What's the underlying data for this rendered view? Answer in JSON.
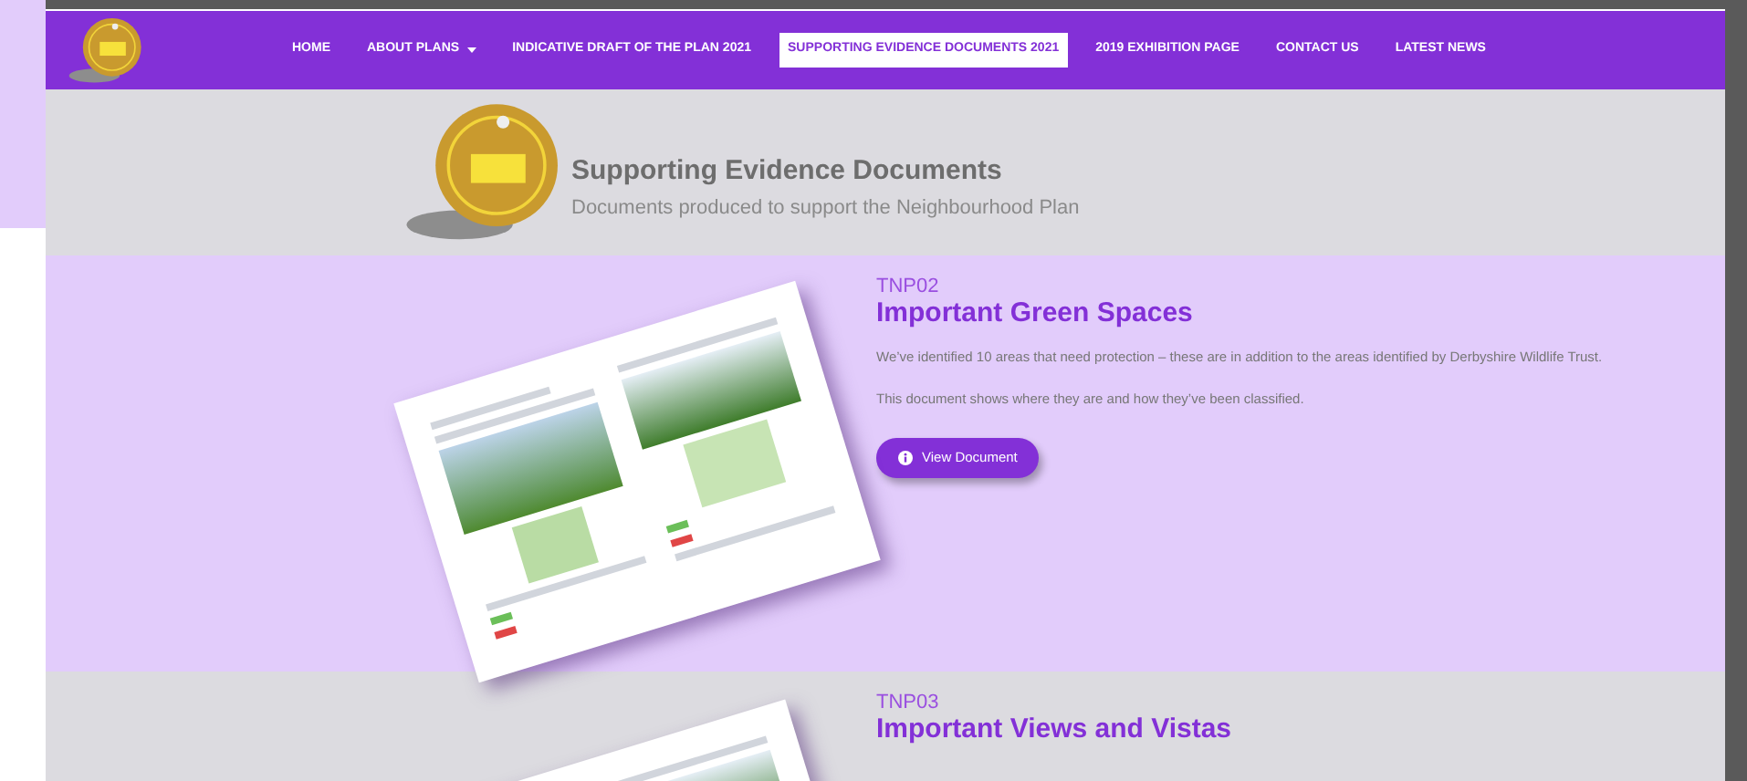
{
  "nav": [
    {
      "label": "HOME",
      "selected": false,
      "dropdown": false
    },
    {
      "label": "ABOUT PLANS",
      "selected": false,
      "dropdown": true
    },
    {
      "label": "INDICATIVE DRAFT OF THE PLAN 2021",
      "selected": false,
      "dropdown": false
    },
    {
      "label": "SUPPORTING EVIDENCE DOCUMENTS 2021",
      "selected": true,
      "dropdown": false
    },
    {
      "label": "2019 EXHIBITION PAGE",
      "selected": false,
      "dropdown": false
    },
    {
      "label": "CONTACT US",
      "selected": false,
      "dropdown": false
    },
    {
      "label": "LATEST NEWS",
      "selected": false,
      "dropdown": false
    }
  ],
  "header": {
    "title": "Supporting Evidence Documents",
    "subtitle": "Documents produced to support the Neighbourhood Plan"
  },
  "documents": [
    {
      "code": "TNP02",
      "title": "Important Green Spaces",
      "paragraphs": [
        "We’ve identified 10 areas that need protection – these are in addition to the areas identified by Derbyshire Wildlife Trust.",
        "This document shows where they are and how they’ve been classified."
      ],
      "button": "View Document"
    },
    {
      "code": "TNP03",
      "title": "Important Views and Vistas"
    }
  ]
}
